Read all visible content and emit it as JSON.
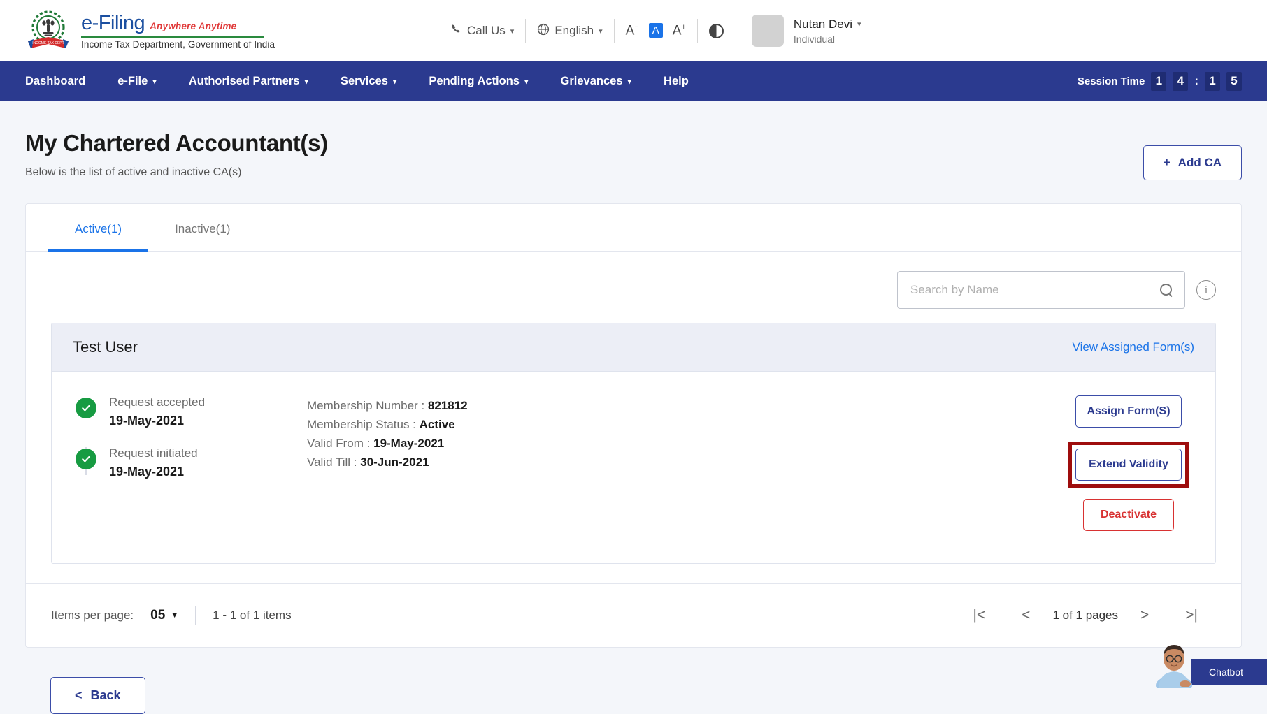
{
  "header": {
    "brand": {
      "name": "e-Filing",
      "tagline": "Anywhere Anytime",
      "department": "Income Tax Department, Government of India"
    },
    "call_us": "Call Us",
    "language": "English",
    "font_decrease": "A",
    "font_normal": "A",
    "font_increase": "A",
    "user_name": "Nutan Devi",
    "user_role": "Individual"
  },
  "nav": {
    "items": [
      {
        "label": "Dashboard",
        "has_caret": false
      },
      {
        "label": "e-File",
        "has_caret": true
      },
      {
        "label": "Authorised Partners",
        "has_caret": true
      },
      {
        "label": "Services",
        "has_caret": true
      },
      {
        "label": "Pending Actions",
        "has_caret": true
      },
      {
        "label": "Grievances",
        "has_caret": true
      },
      {
        "label": "Help",
        "has_caret": false
      }
    ],
    "session_label": "Session Time",
    "session_digits": [
      "1",
      "4",
      "1",
      "5"
    ],
    "session_separator": ":"
  },
  "page": {
    "title": "My Chartered Accountant(s)",
    "subtitle": "Below is the list of active and inactive CA(s)",
    "add_ca_label": "Add CA",
    "add_ca_icon": "+"
  },
  "tabs": [
    {
      "label": "Active(1)",
      "active": true
    },
    {
      "label": "Inactive(1)",
      "active": false
    }
  ],
  "search": {
    "placeholder": "Search by Name",
    "value": "",
    "info_glyph": "i"
  },
  "ca_card": {
    "name": "Test User",
    "view_forms_link": "View Assigned Form(s)",
    "timeline": [
      {
        "label": "Request accepted",
        "date": "19-May-2021"
      },
      {
        "label": "Request initiated",
        "date": "19-May-2021"
      }
    ],
    "details": [
      {
        "label": "Membership Number :",
        "value": "821812"
      },
      {
        "label": "Membership Status :",
        "value": "Active"
      },
      {
        "label": "Valid From :",
        "value": "19-May-2021"
      },
      {
        "label": "Valid Till :",
        "value": "30-Jun-2021"
      }
    ],
    "actions": {
      "assign_forms": "Assign Form(S)",
      "extend_validity": "Extend Validity",
      "deactivate": "Deactivate"
    }
  },
  "pagination": {
    "items_per_page_label": "Items per page:",
    "items_per_page_value": "05",
    "range_text": "1 - 1 of 1 items",
    "first_icon": "|<",
    "prev_icon": "<",
    "page_text": "1 of 1 pages",
    "next_icon": ">",
    "last_icon": ">|"
  },
  "footer": {
    "back_label": "Back",
    "back_icon": "<"
  },
  "chatbot": {
    "label": "Chatbot"
  },
  "colors": {
    "nav_blue": "#2b3a8f",
    "accent_blue": "#1a73e8",
    "danger_red": "#d83232",
    "highlight_red": "#9e0d0d",
    "success_green": "#179b42"
  }
}
